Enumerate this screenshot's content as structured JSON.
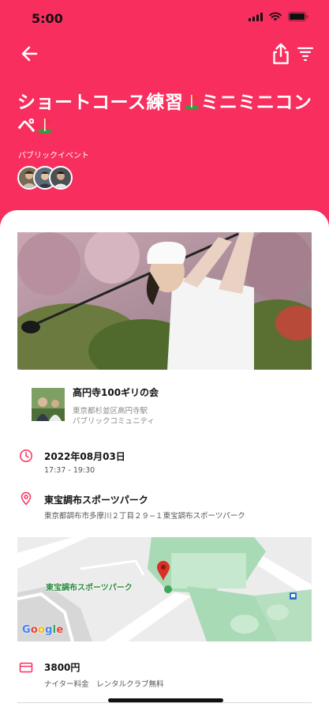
{
  "status_bar": {
    "time": "5:00"
  },
  "event": {
    "title_part1": "ショートコース練習",
    "title_part2": "ミニミニコンペ",
    "type_label": "パブリックイベント"
  },
  "community": {
    "name": "高円寺100ギリの会",
    "location": "東京都杉並区高円寺駅",
    "type": "パブリックコミュニティ"
  },
  "schedule": {
    "date": "2022年08月03日",
    "time": "17:37 - 19:30"
  },
  "venue": {
    "name": "東宝調布スポーツパーク",
    "address": "東京都調布市多摩川２丁目２９−１東宝調布スポーツパーク"
  },
  "map": {
    "label": "東宝調布スポーツパーク",
    "provider": "Google"
  },
  "fee": {
    "price": "3800円",
    "note": "ナイター料金　レンタルクラブ無料"
  },
  "colors": {
    "accent": "#f72e5e",
    "map_pin": "#d93025",
    "map_park": "#a8dab5"
  },
  "icons": [
    "back-arrow-icon",
    "share-icon",
    "filter-icon",
    "clock-icon",
    "location-pin-icon",
    "credit-card-icon"
  ]
}
